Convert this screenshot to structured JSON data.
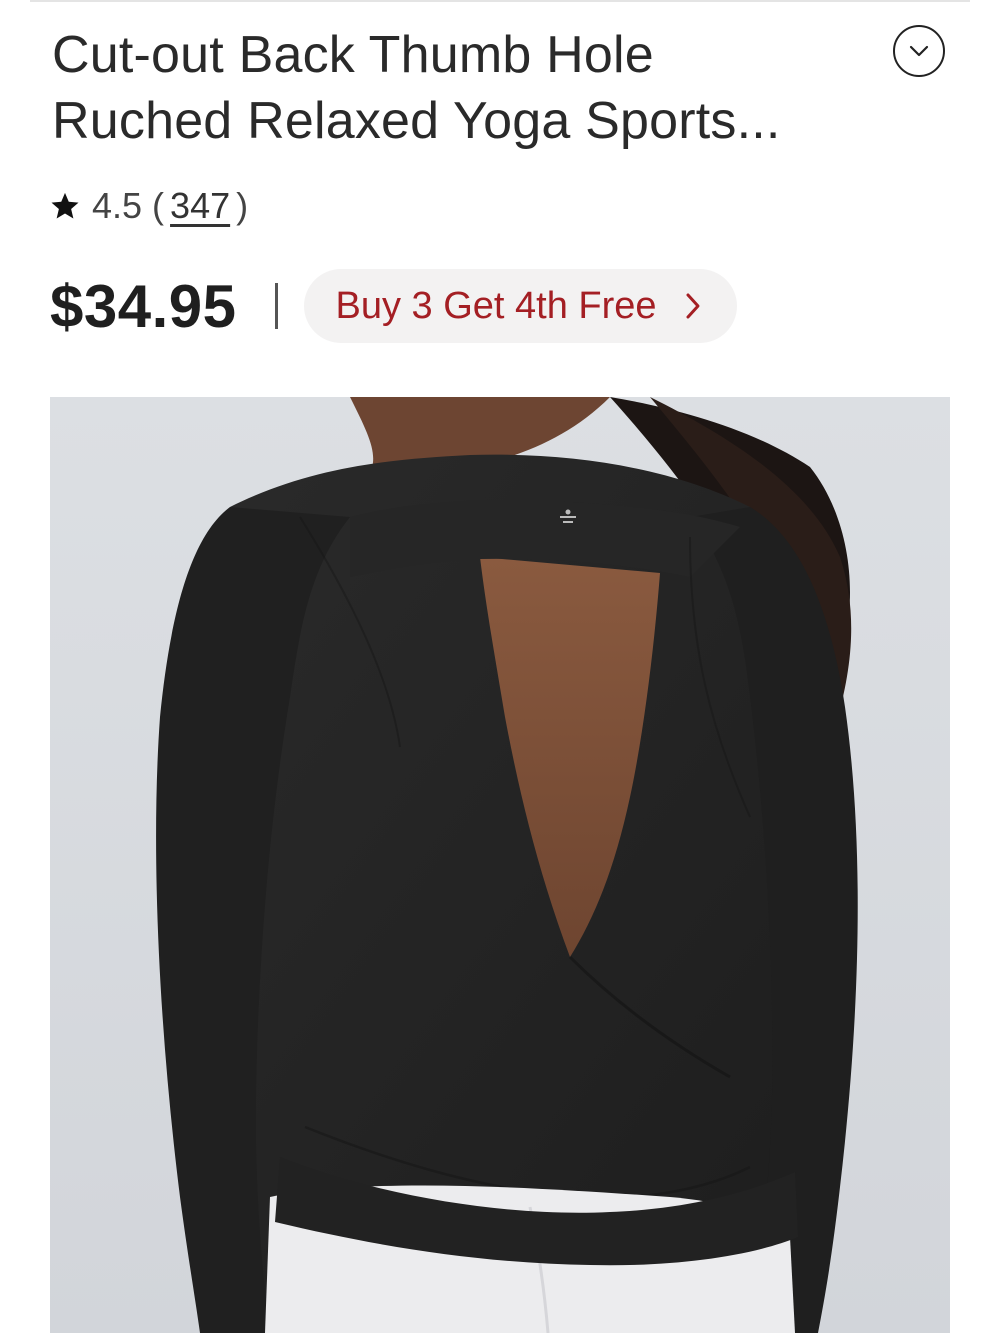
{
  "product": {
    "title_line1": "Cut-out Back Thumb Hole",
    "title_line2": "Ruched Relaxed Yoga Sports...",
    "rating": "4.5",
    "rating_open": "(",
    "review_count": "347",
    "rating_close": ")",
    "price": "$34.95",
    "promo_label": "Buy 3 Get 4th Free"
  },
  "icons": {
    "collapse": "chevron-down-icon",
    "star": "star-icon",
    "promo_arrow": "chevron-right-icon"
  },
  "colors": {
    "promo_text": "#a41f24",
    "promo_bg": "#f3f2f2",
    "garment": "#242424",
    "background_photo": "#d8dbe0"
  }
}
